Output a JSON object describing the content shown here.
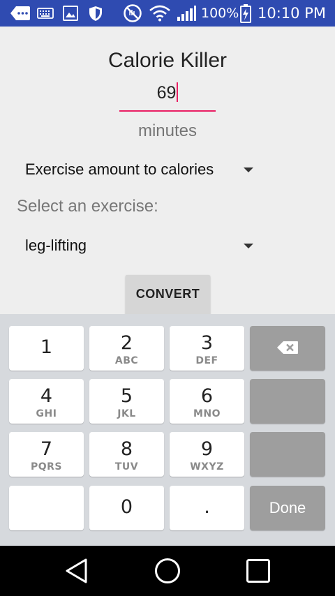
{
  "status_bar": {
    "battery_percent": "100%",
    "time": "10:10 PM",
    "icons": [
      "notification-icon",
      "keyboard-icon",
      "image-icon",
      "shield-icon",
      "do-not-disturb-icon",
      "wifi-icon",
      "signal-icon",
      "battery-charging-icon"
    ],
    "background_color": "#2f4bb1"
  },
  "app": {
    "title": "Calorie Killer",
    "minutes_value": "69",
    "unit_label": "minutes",
    "mode_spinner": {
      "selected": "Exercise amount to calories"
    },
    "select_exercise_label": "Select an exercise:",
    "exercise_spinner": {
      "selected": "leg-lifting"
    },
    "convert_button": "CONVERT",
    "accent_color": "#e91e63"
  },
  "keyboard": {
    "keys": [
      {
        "num": "1",
        "letters": ""
      },
      {
        "num": "2",
        "letters": "ABC"
      },
      {
        "num": "3",
        "letters": "DEF"
      },
      {
        "num": "4",
        "letters": "GHI"
      },
      {
        "num": "5",
        "letters": "JKL"
      },
      {
        "num": "6",
        "letters": "MNO"
      },
      {
        "num": "7",
        "letters": "PQRS"
      },
      {
        "num": "8",
        "letters": "TUV"
      },
      {
        "num": "9",
        "letters": "WXYZ"
      },
      {
        "num": "0",
        "letters": ""
      },
      {
        "num": ".",
        "letters": ""
      }
    ],
    "done_label": "Done",
    "backspace_icon": "backspace-icon"
  },
  "nav_bar": {
    "icons": [
      "back-icon",
      "home-icon",
      "recents-icon"
    ]
  }
}
